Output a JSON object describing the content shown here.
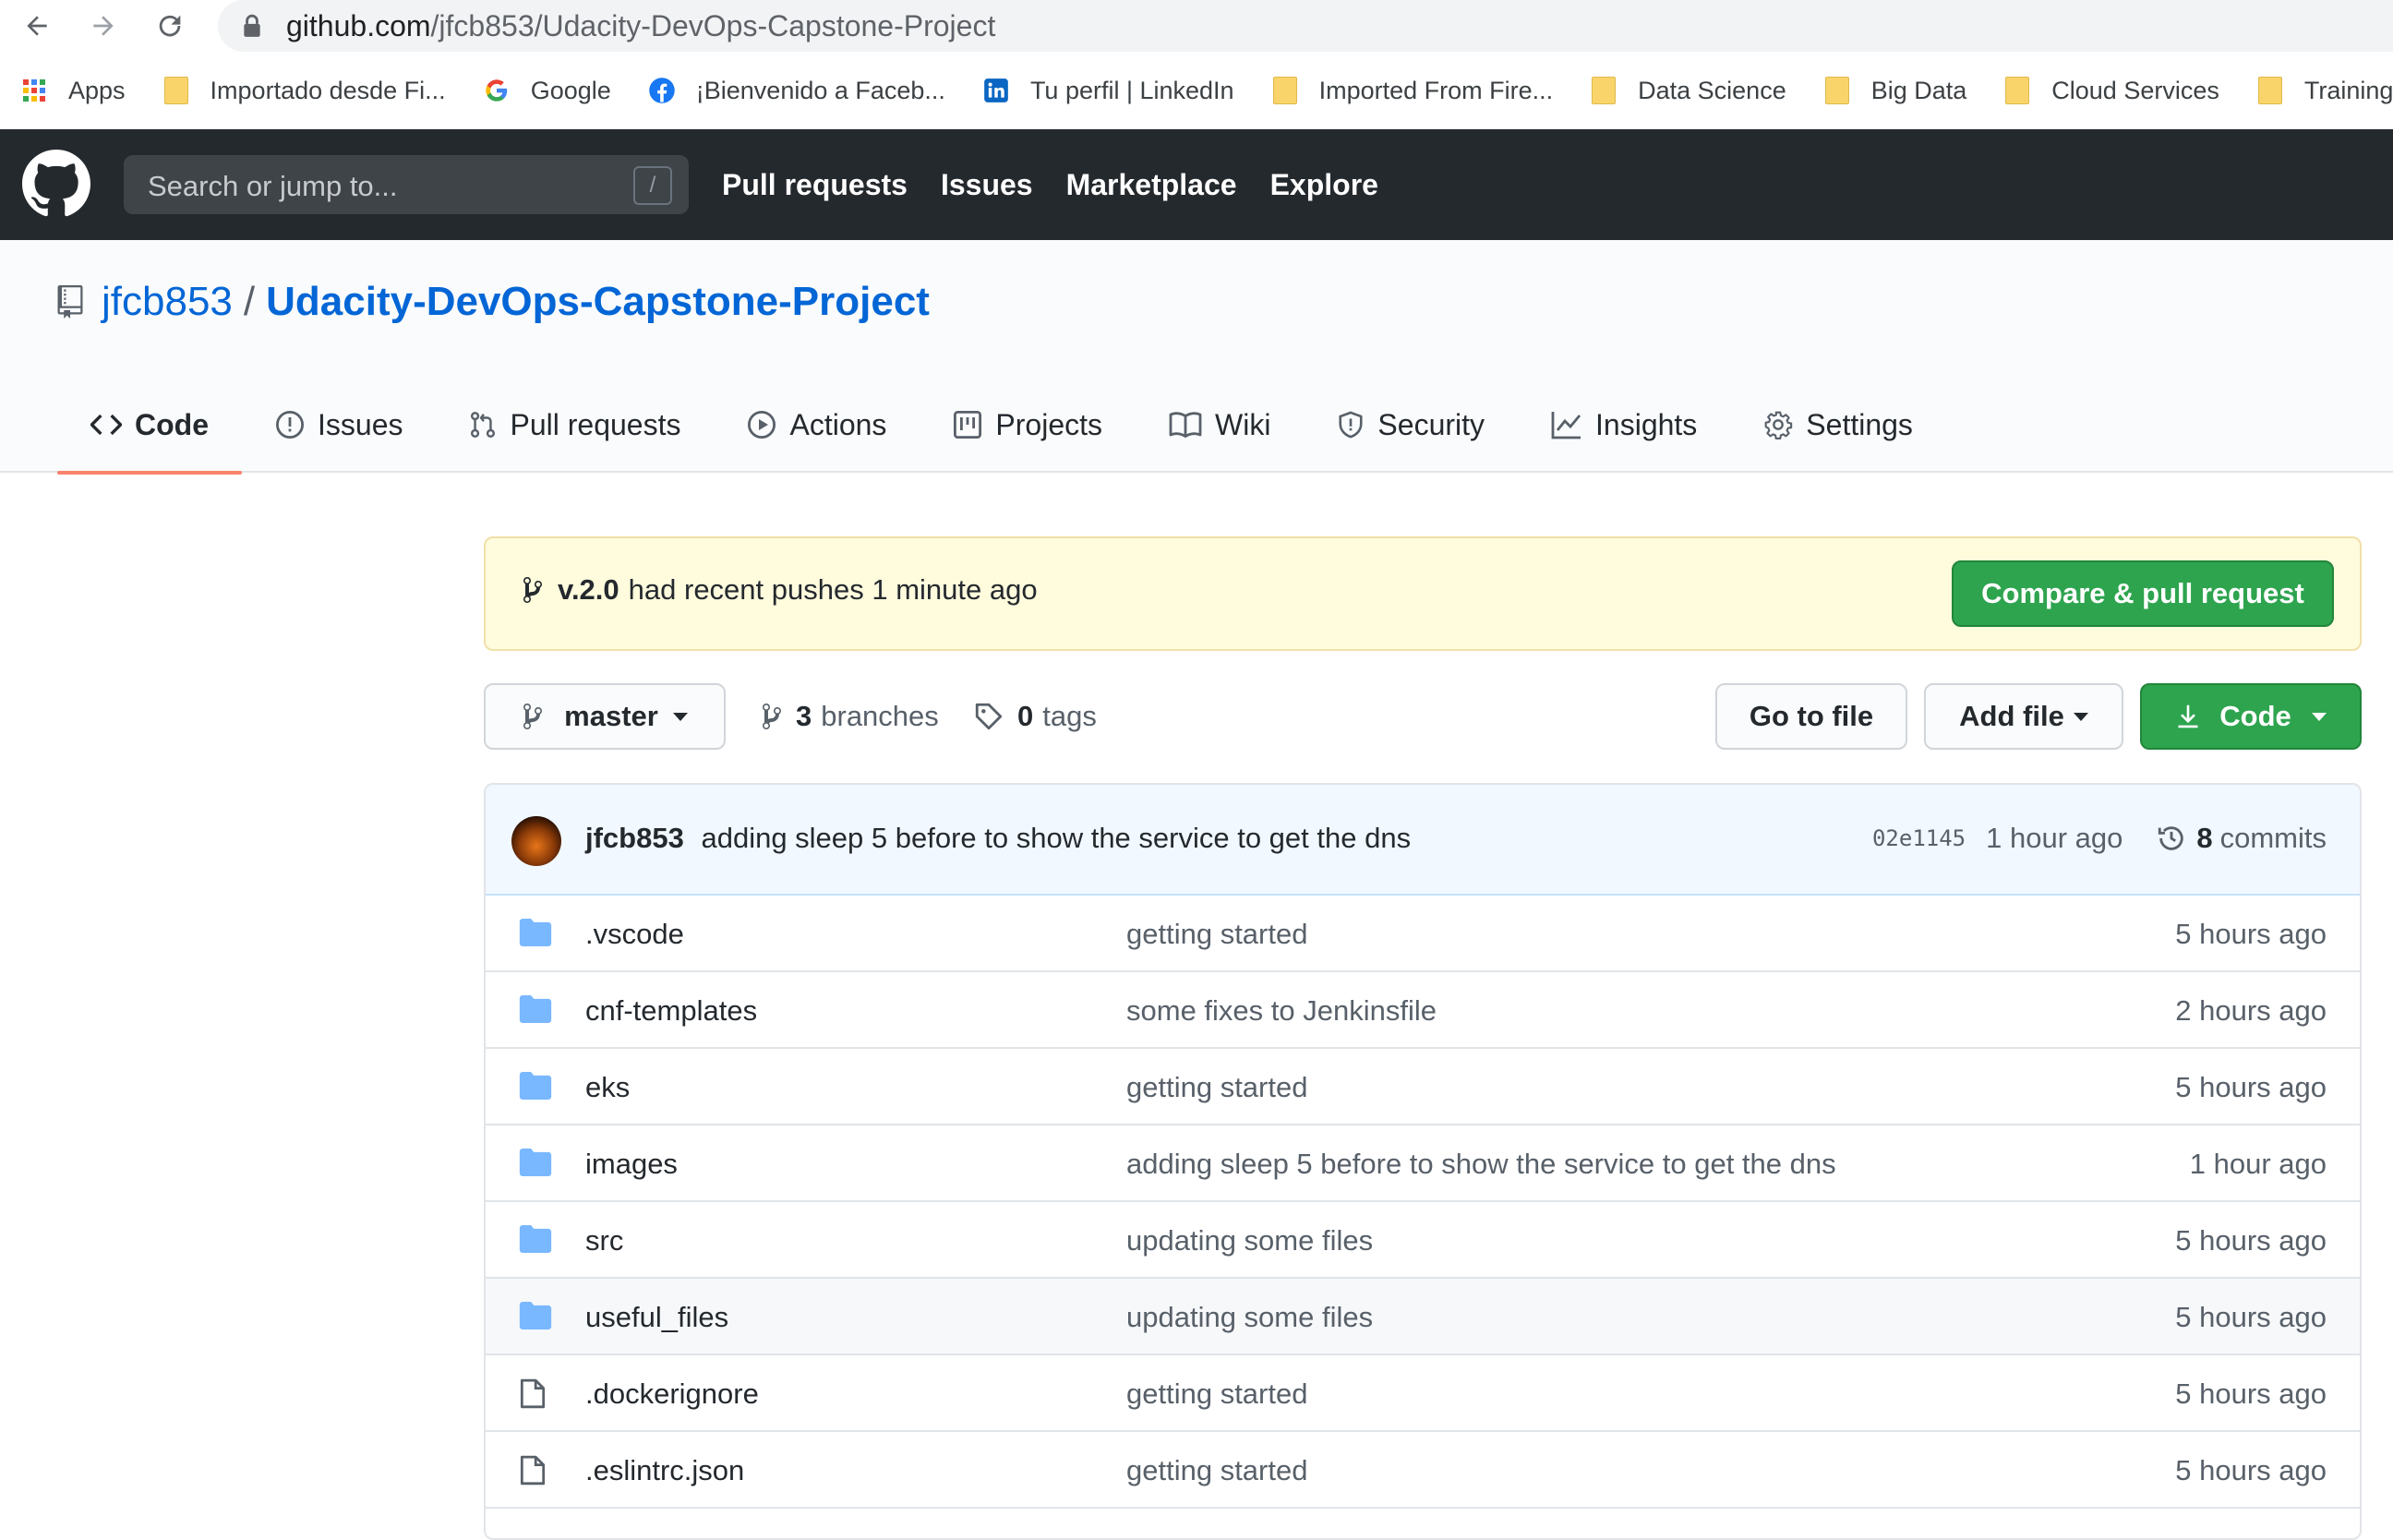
{
  "browser": {
    "url_host": "github.com",
    "url_path": "/jfcb853/Udacity-DevOps-Capstone-Project",
    "bookmarks": [
      {
        "label": "Apps",
        "icon": "apps-grid-icon"
      },
      {
        "label": "Importado desde Fi...",
        "icon": "folder-icon"
      },
      {
        "label": "Google",
        "icon": "google-icon"
      },
      {
        "label": "¡Bienvenido a Faceb...",
        "icon": "facebook-icon"
      },
      {
        "label": "Tu perfil | LinkedIn",
        "icon": "linkedin-icon"
      },
      {
        "label": "Imported From Fire...",
        "icon": "folder-icon"
      },
      {
        "label": "Data Science",
        "icon": "folder-icon"
      },
      {
        "label": "Big Data",
        "icon": "folder-icon"
      },
      {
        "label": "Cloud Services",
        "icon": "folder-icon"
      },
      {
        "label": "Training",
        "icon": "folder-icon"
      }
    ]
  },
  "header": {
    "search_placeholder": "Search or jump to...",
    "search_shortcut": "/",
    "nav": [
      "Pull requests",
      "Issues",
      "Marketplace",
      "Explore"
    ]
  },
  "repo": {
    "owner": "jfcb853",
    "separator": "/",
    "name": "Udacity-DevOps-Capstone-Project",
    "tabs": [
      {
        "label": "Code",
        "icon": "code-icon",
        "selected": true
      },
      {
        "label": "Issues",
        "icon": "issue-opened-icon"
      },
      {
        "label": "Pull requests",
        "icon": "git-pull-request-icon"
      },
      {
        "label": "Actions",
        "icon": "play-icon"
      },
      {
        "label": "Projects",
        "icon": "project-icon"
      },
      {
        "label": "Wiki",
        "icon": "book-icon"
      },
      {
        "label": "Security",
        "icon": "shield-icon"
      },
      {
        "label": "Insights",
        "icon": "graph-icon"
      },
      {
        "label": "Settings",
        "icon": "gear-icon"
      }
    ]
  },
  "banner": {
    "branch": "v.2.0",
    "text": "had recent pushes 1 minute ago",
    "button": "Compare & pull request"
  },
  "toolbar": {
    "branch": "master",
    "branches_count": "3",
    "branches_label": "branches",
    "tags_count": "0",
    "tags_label": "tags",
    "go_to_file": "Go to file",
    "add_file": "Add file",
    "code": "Code"
  },
  "commit": {
    "author": "jfcb853",
    "message": "adding sleep 5 before to show the service to get the dns",
    "sha": "02e1145",
    "age": "1 hour ago",
    "commits_count": "8",
    "commits_label": "commits"
  },
  "files": [
    {
      "name": ".vscode",
      "type": "dir",
      "message": "getting started",
      "age": "5 hours ago"
    },
    {
      "name": "cnf-templates",
      "type": "dir",
      "message": "some fixes to Jenkinsfile",
      "age": "2 hours ago"
    },
    {
      "name": "eks",
      "type": "dir",
      "message": "getting started",
      "age": "5 hours ago"
    },
    {
      "name": "images",
      "type": "dir",
      "message": "adding sleep 5 before to show the service to get the dns",
      "age": "1 hour ago"
    },
    {
      "name": "src",
      "type": "dir",
      "message": "updating some files",
      "age": "5 hours ago"
    },
    {
      "name": "useful_files",
      "type": "dir",
      "message": "updating some files",
      "age": "5 hours ago"
    },
    {
      "name": ".dockerignore",
      "type": "file",
      "message": "getting started",
      "age": "5 hours ago"
    },
    {
      "name": ".eslintrc.json",
      "type": "file",
      "message": "getting started",
      "age": "5 hours ago"
    }
  ],
  "colors": {
    "header_bg": "#24292e",
    "link_blue": "#0366d6",
    "green_button": "#2ea44f",
    "banner_bg": "#fffbdd",
    "selected_tab_underline": "#f9826c",
    "folder_blue": "#79b8ff"
  }
}
